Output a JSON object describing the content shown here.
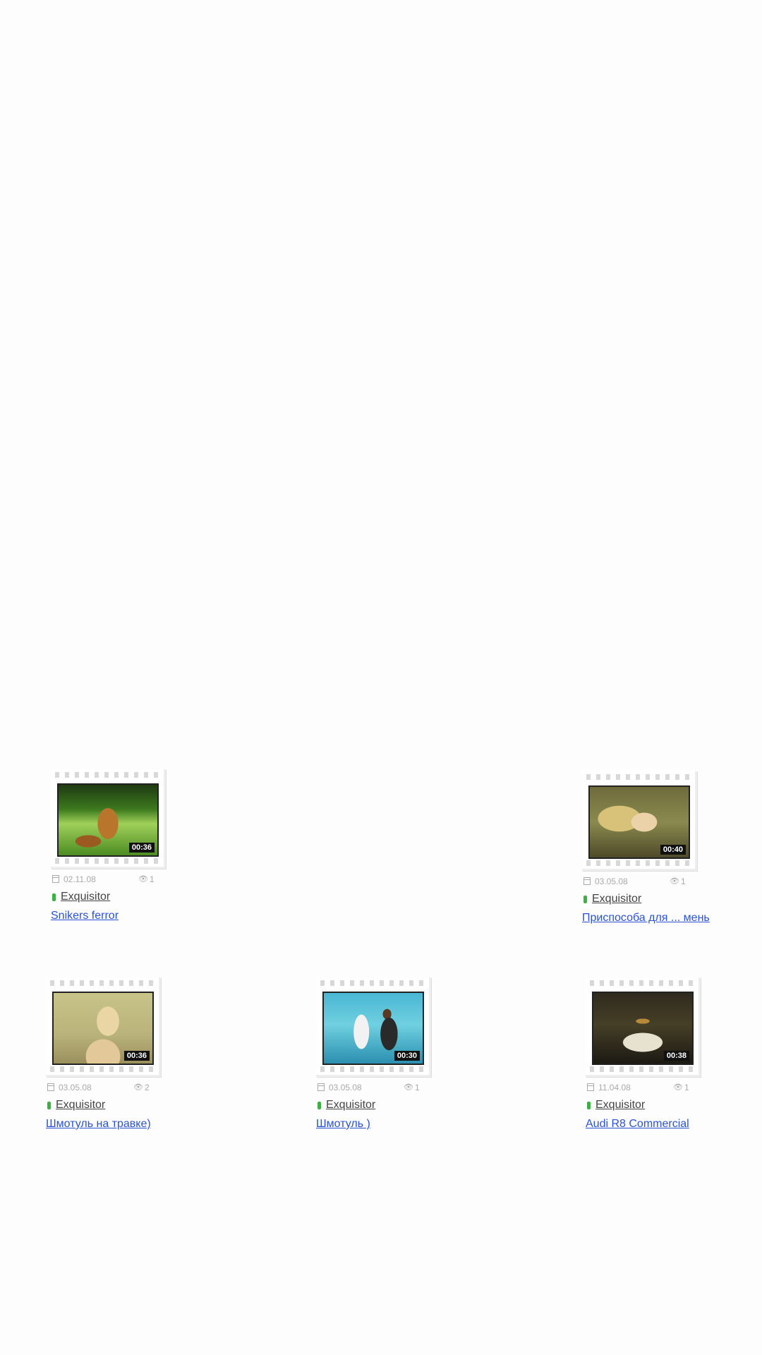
{
  "videos": [
    {
      "duration": "00:36",
      "date": "02.11.08",
      "views": "1",
      "author": "Exquisitor",
      "title": "Snikers ferror",
      "thumbnail": "tiger-in-grass"
    },
    {
      "duration": "00:40",
      "date": "03.05.08",
      "views": "1",
      "author": "Exquisitor",
      "title": "Приспособа для ... мень",
      "thumbnail": "blonde-woman"
    },
    {
      "duration": "00:36",
      "date": "03.05.08",
      "views": "2",
      "author": "Exquisitor",
      "title": "Шмотуль на травке)",
      "thumbnail": "woman-in-shower"
    },
    {
      "duration": "00:30",
      "date": "03.05.08",
      "views": "1",
      "author": "Exquisitor",
      "title": "Шмотуль )",
      "thumbnail": "couple-at-pool"
    },
    {
      "duration": "00:38",
      "date": "11.04.08",
      "views": "1",
      "author": "Exquisitor",
      "title": "Audi R8 Commercial",
      "thumbnail": "audi-car"
    }
  ],
  "icons": {
    "date": "calendar-icon",
    "views": "eye-icon",
    "author": "user-icon"
  },
  "colors": {
    "link": "#2a52d6",
    "author_marker": "#3cb043",
    "meta_text": "#aaaaaa"
  }
}
